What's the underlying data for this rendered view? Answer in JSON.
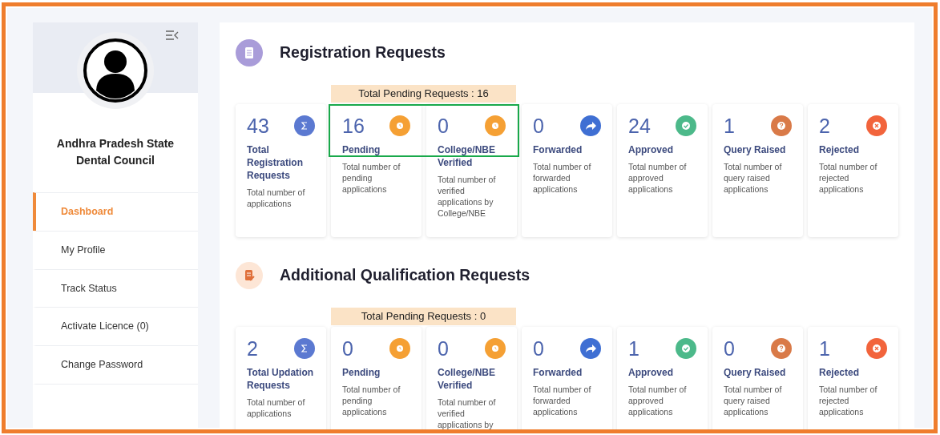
{
  "sidebar": {
    "org_name": "Andhra Pradesh State Dental Council",
    "items": [
      {
        "label": "Dashboard",
        "selected": true
      },
      {
        "label": "My Profile",
        "selected": false
      },
      {
        "label": "Track Status",
        "selected": false
      },
      {
        "label": "Activate Licence (0)",
        "selected": false
      },
      {
        "label": "Change Password",
        "selected": false
      }
    ]
  },
  "sections": [
    {
      "title": "Registration Requests",
      "kind": "registration",
      "pending_banner": "Total Pending Requests : 16",
      "cards": [
        {
          "kind": "total",
          "count": "43",
          "label": "Total Registration Requests",
          "description": "Total number of applications",
          "highlighted": false
        },
        {
          "kind": "pending",
          "count": "16",
          "label": "Pending",
          "description": "Total number of pending applications",
          "highlighted": true
        },
        {
          "kind": "verified",
          "count": "0",
          "label": "College/NBE Verified",
          "description": "Total number of verified applications by College/NBE",
          "highlighted": true
        },
        {
          "kind": "forwarded",
          "count": "0",
          "label": "Forwarded",
          "description": "Total number of forwarded applications",
          "highlighted": false
        },
        {
          "kind": "approved",
          "count": "24",
          "label": "Approved",
          "description": "Total number of approved applications",
          "highlighted": false
        },
        {
          "kind": "query",
          "count": "1",
          "label": "Query Raised",
          "description": "Total number of query raised applications",
          "highlighted": false
        },
        {
          "kind": "rejected",
          "count": "2",
          "label": "Rejected",
          "description": "Total number of rejected applications",
          "highlighted": false
        }
      ]
    },
    {
      "title": "Additional Qualification Requests",
      "kind": "qualification",
      "pending_banner": "Total Pending Requests : 0",
      "cards": [
        {
          "kind": "total",
          "count": "2",
          "label": "Total Updation Requests",
          "description": "Total number of applications",
          "highlighted": false
        },
        {
          "kind": "pending",
          "count": "0",
          "label": "Pending",
          "description": "Total number of pending applications",
          "highlighted": false
        },
        {
          "kind": "verified",
          "count": "0",
          "label": "College/NBE Verified",
          "description": "Total number of verified applications by",
          "highlighted": false
        },
        {
          "kind": "forwarded",
          "count": "0",
          "label": "Forwarded",
          "description": "Total number of forwarded applications",
          "highlighted": false
        },
        {
          "kind": "approved",
          "count": "1",
          "label": "Approved",
          "description": "Total number of approved applications",
          "highlighted": false
        },
        {
          "kind": "query",
          "count": "0",
          "label": "Query Raised",
          "description": "Total number of query raised applications",
          "highlighted": false
        },
        {
          "kind": "rejected",
          "count": "1",
          "label": "Rejected",
          "description": "Total number of rejected applications",
          "highlighted": false
        }
      ]
    }
  ]
}
